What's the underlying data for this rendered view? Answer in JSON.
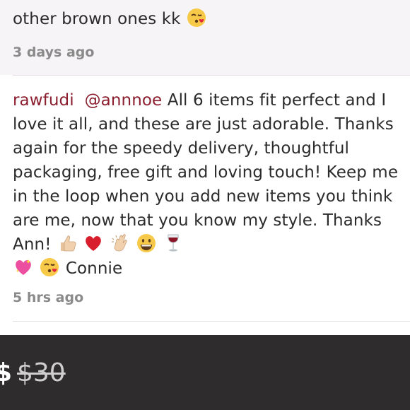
{
  "previous_comment": {
    "text_tail": "other brown ones kk",
    "emoji": "kissing-face-emoji",
    "timestamp": "3 days ago"
  },
  "main_comment": {
    "username": "rawfudi",
    "mention": "@annnoe",
    "message": "All 6 items fit perfect and I love it all, and these are just adorable. Thanks again for the speedy delivery, thoughtful packaging, free gift and loving touch! Keep me in the loop when you add new items you think are me, now that you know my style. Thanks Ann!",
    "emojis": [
      "thumbs-up-emoji",
      "red-heart-emoji",
      "clapping-hands-emoji",
      "grinning-face-emoji",
      "wine-glass-emoji",
      "sparkling-heart-emoji",
      "kissing-face-emoji"
    ],
    "signature": "Connie",
    "timestamp": "5 hrs ago"
  },
  "price_bar": {
    "cut_symbol": "$",
    "original_price": "$30"
  },
  "colors": {
    "username": "#8b1f2f",
    "timestamp": "#8a8a8a",
    "bar_background": "#2e2c2d"
  }
}
